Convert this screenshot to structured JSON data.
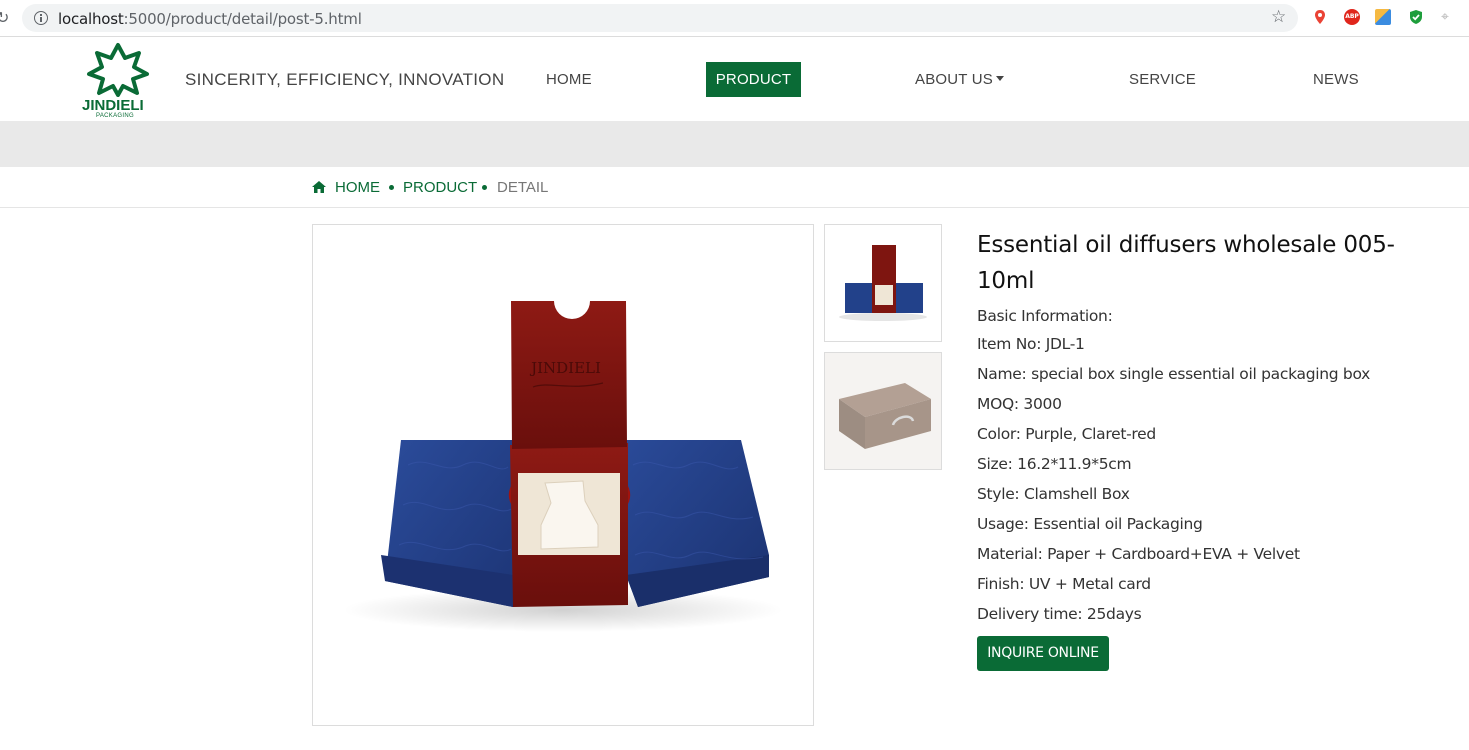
{
  "browser": {
    "url_host": "localhost",
    "url_rest": ":5000/product/detail/post-5.html"
  },
  "header": {
    "logo_text": "JINDIELI",
    "logo_sub": "PACKAGING",
    "slogan": "SINCERITY, EFFICIENCY, INNOVATION",
    "nav": {
      "home": "HOME",
      "product": "PRODUCT",
      "about": "ABOUT US",
      "service": "SERVICE",
      "news": "NEWS"
    }
  },
  "breadcrumb": {
    "home": "HOME",
    "product": "PRODUCT",
    "detail": "DETAIL"
  },
  "product": {
    "title": "Essential oil diffusers wholesale 005-10ml",
    "basic_info": "Basic Information:",
    "specs": [
      "Item No: JDL-1",
      "Name: special box single essential oil packaging box",
      "MOQ: 3000",
      "Color: Purple, Claret-red",
      "Size: 16.2*11.9*5cm",
      "Style: Clamshell Box",
      "Usage: Essential oil Packaging",
      "Material: Paper + Cardboard+EVA + Velvet",
      "Finish: UV + Metal card",
      "Delivery time: 25days"
    ],
    "inquire_label": "INQUIRE ONLINE",
    "box_brand": "JINDIELI"
  },
  "colors": {
    "brand_green": "#0a6b36",
    "band_gray": "#e9e9e9"
  }
}
